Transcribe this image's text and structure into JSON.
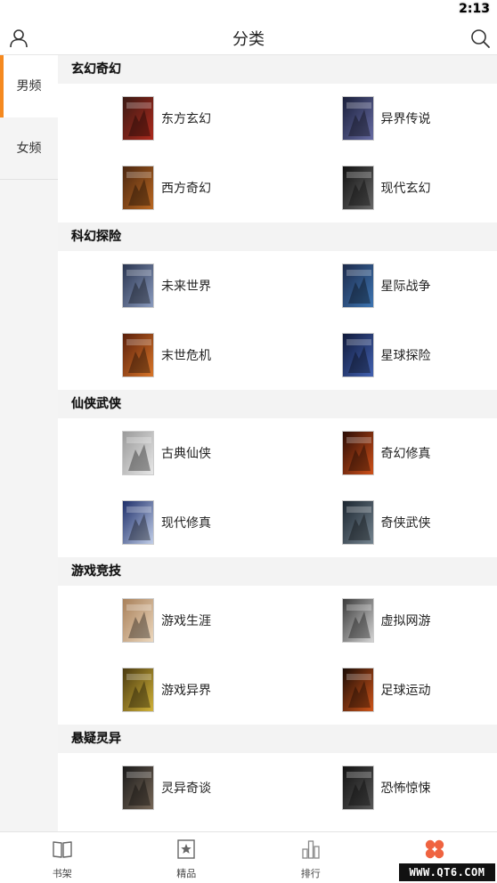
{
  "status_bar": {
    "time": "2:13"
  },
  "header": {
    "title": "分类"
  },
  "sidebar": {
    "tabs": [
      {
        "label": "男频"
      },
      {
        "label": "女频"
      }
    ]
  },
  "sections": [
    {
      "title": "玄幻奇幻",
      "items": [
        {
          "label": "东方玄幻",
          "cover_colors": [
            "#3a1a14",
            "#b32a1d"
          ]
        },
        {
          "label": "异界传说",
          "cover_colors": [
            "#1a1f3a",
            "#6a6fa8"
          ]
        },
        {
          "label": "西方奇幻",
          "cover_colors": [
            "#4a2610",
            "#c06b22"
          ]
        },
        {
          "label": "现代玄幻",
          "cover_colors": [
            "#111111",
            "#6b6b6b"
          ]
        }
      ]
    },
    {
      "title": "科幻探险",
      "items": [
        {
          "label": "未来世界",
          "cover_colors": [
            "#2a3550",
            "#8fa0c4"
          ]
        },
        {
          "label": "星际战争",
          "cover_colors": [
            "#1d2a4a",
            "#3f79b8"
          ]
        },
        {
          "label": "末世危机",
          "cover_colors": [
            "#5a1f0b",
            "#e07a2a"
          ]
        },
        {
          "label": "星球探险",
          "cover_colors": [
            "#101a3a",
            "#4565b8"
          ]
        }
      ]
    },
    {
      "title": "仙侠武侠",
      "items": [
        {
          "label": "古典仙侠",
          "cover_colors": [
            "#9a9a9a",
            "#ececec"
          ]
        },
        {
          "label": "奇幻修真",
          "cover_colors": [
            "#2a0c06",
            "#d8541a"
          ]
        },
        {
          "label": "现代修真",
          "cover_colors": [
            "#1e2f6a",
            "#c9d6ef"
          ]
        },
        {
          "label": "奇侠武侠",
          "cover_colors": [
            "#1c2630",
            "#788894"
          ]
        }
      ]
    },
    {
      "title": "游戏竞技",
      "items": [
        {
          "label": "游戏生涯",
          "cover_colors": [
            "#a8805a",
            "#f0dcc2"
          ]
        },
        {
          "label": "虚拟网游",
          "cover_colors": [
            "#3a3a3a",
            "#dcdcdc"
          ]
        },
        {
          "label": "游戏异界",
          "cover_colors": [
            "#4a3a10",
            "#d8b83a"
          ]
        },
        {
          "label": "足球运动",
          "cover_colors": [
            "#1a0c06",
            "#d8581a"
          ]
        }
      ]
    },
    {
      "title": "悬疑灵异",
      "items": [
        {
          "label": "灵异奇谈",
          "cover_colors": [
            "#1a1a1a",
            "#7a6a5a"
          ]
        },
        {
          "label": "恐怖惊悚",
          "cover_colors": [
            "#121212",
            "#5a5a5a"
          ]
        }
      ]
    }
  ],
  "bottom_nav": [
    {
      "label": "书架",
      "icon": "book-icon"
    },
    {
      "label": "精品",
      "icon": "star-card-icon"
    },
    {
      "label": "排行",
      "icon": "ranking-bars-icon"
    },
    {
      "label": "",
      "icon": "category-clover-icon"
    }
  ],
  "colors": {
    "accent": "#f5891f",
    "active_nav": "#ef6340"
  },
  "watermark": "WWW.QT6.COM"
}
